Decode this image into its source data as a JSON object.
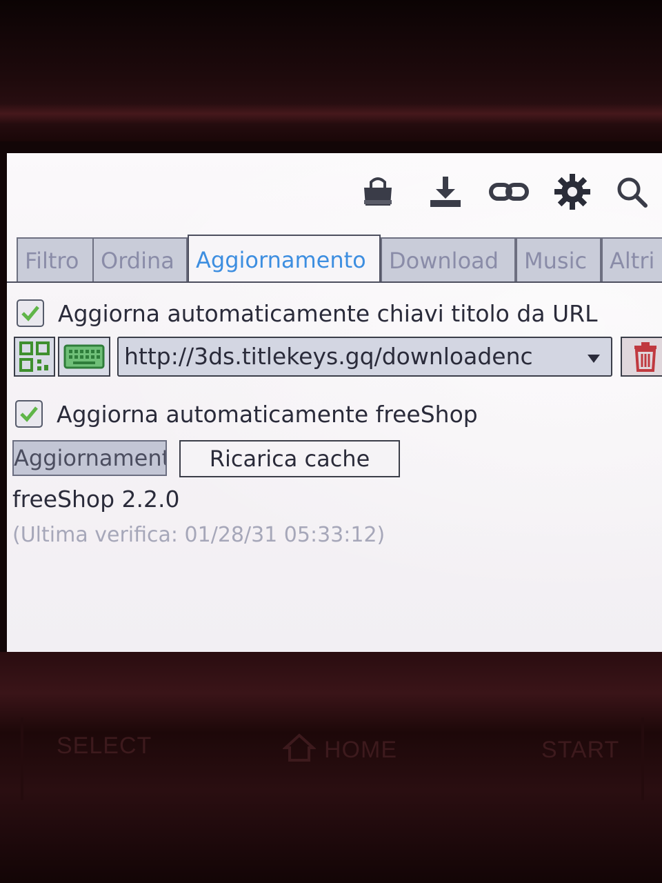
{
  "toolbar": {
    "icons": [
      "shop-bag-icon",
      "download-icon",
      "link-icon",
      "gear-icon",
      "search-icon"
    ]
  },
  "tabs": [
    {
      "label": "Filtro",
      "active": false
    },
    {
      "label": "Ordina",
      "active": false
    },
    {
      "label": "Aggiornamento",
      "active": true
    },
    {
      "label": "Download",
      "active": false
    },
    {
      "label": "Music",
      "active": false
    },
    {
      "label": "Altri",
      "active": false
    }
  ],
  "update_settings": {
    "auto_titlekeys_label": "Aggiorna automaticamente chiavi titolo da URL",
    "auto_titlekeys_checked": true,
    "url_value": "http://3ds.titlekeys.gq/downloadenc",
    "auto_freeshop_label": "Aggiorna automaticamente freeShop",
    "auto_freeshop_checked": true,
    "update_button_label": "Aggiornamento",
    "reload_cache_button_label": "Ricarica cache",
    "version_text": "freeShop 2.2.0",
    "last_check_text": "(Ultima verifica: 01/28/31 05:33:12)"
  },
  "hardware_buttons": {
    "select": "SELECT",
    "home": "HOME",
    "start": "START"
  },
  "colors": {
    "active_tab_text": "#3d8ee0",
    "inactive_tab_bg": "#c9ccd9",
    "check_green": "#5fb548",
    "trash_red": "#c0393f"
  }
}
